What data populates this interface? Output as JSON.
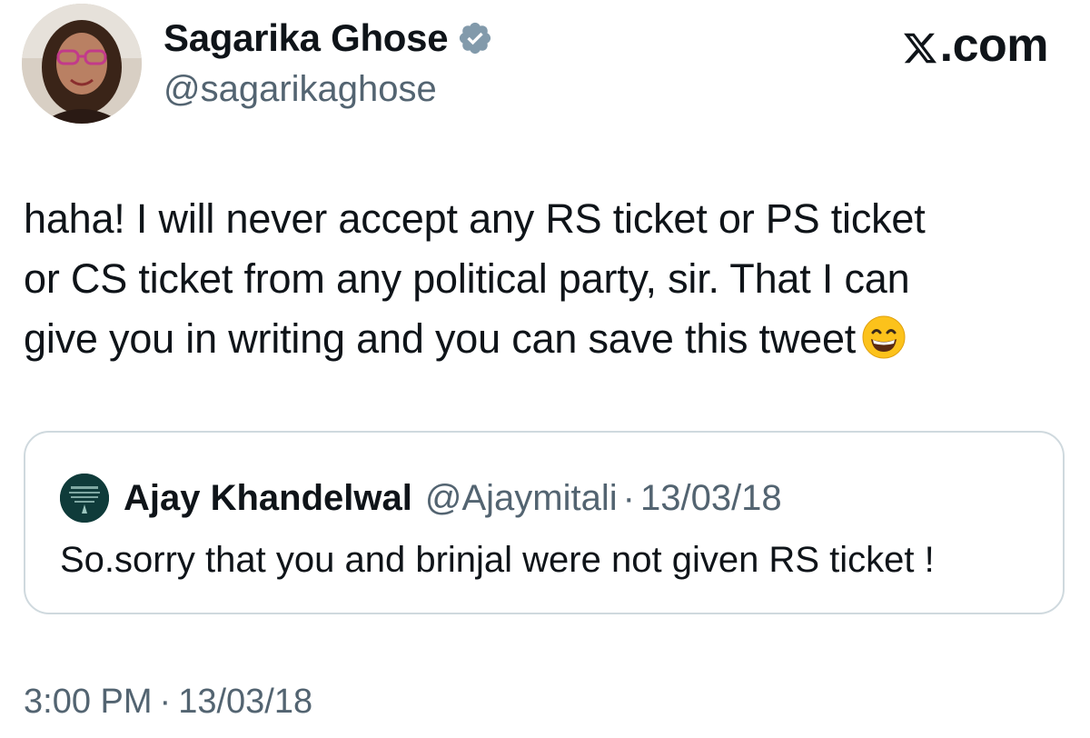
{
  "author": {
    "name": "Sagarika Ghose",
    "handle": "@sagarikaghose",
    "verified": true
  },
  "brand": {
    "text": ".com",
    "icon": "x-logo-icon"
  },
  "tweet": {
    "lines": [
      "haha! I will never accept any RS ticket or PS ticket",
      "or CS ticket from any political party, sir. That I can",
      "give you in writing and you can save this tweet"
    ],
    "emoji": "grinning-face-emoji"
  },
  "quoted_tweet": {
    "name": "Ajay Khandelwal",
    "handle": "@Ajaymitali",
    "separator": "·",
    "date": "13/03/18",
    "text": "So.sorry that you and brinjal were not given RS ticket !"
  },
  "footer": {
    "time": "3:00 PM",
    "separator": "·",
    "date": "13/03/18"
  },
  "colors": {
    "text_primary": "#0f1419",
    "text_secondary": "#536471",
    "border": "#cfd9de",
    "verified_badge": "#829aab"
  }
}
